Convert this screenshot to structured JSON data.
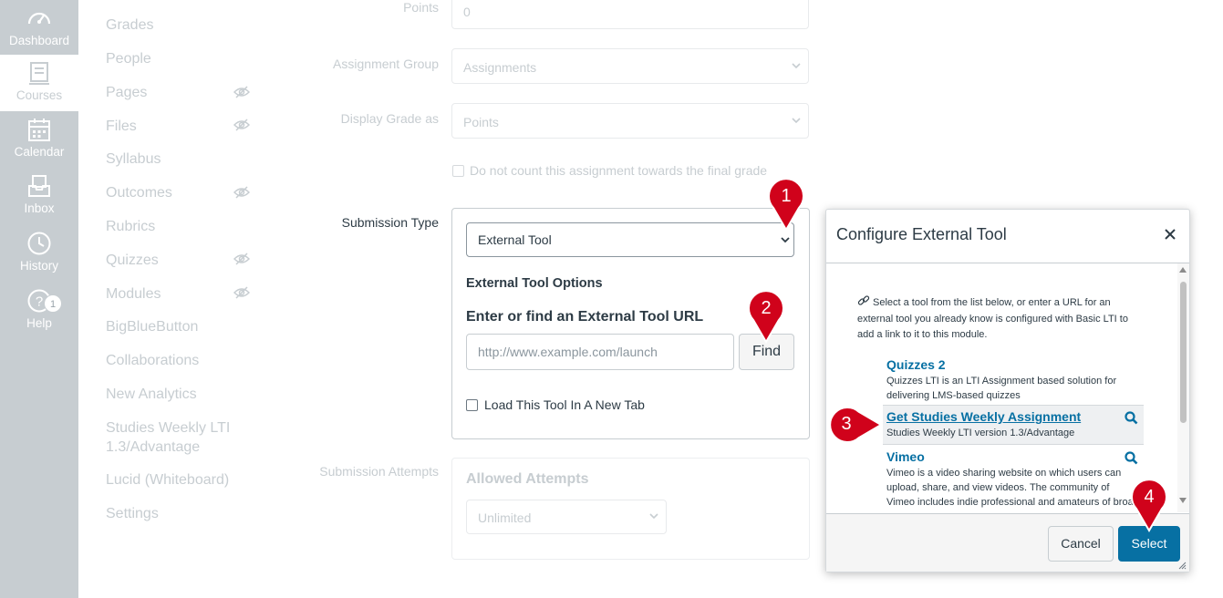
{
  "global_nav": {
    "dashboard": "Dashboard",
    "courses": "Courses",
    "calendar": "Calendar",
    "inbox": "Inbox",
    "history": "History",
    "help": "Help",
    "help_badge": "1"
  },
  "course_nav": [
    "Grades",
    "People",
    "Pages",
    "Files",
    "Syllabus",
    "Outcomes",
    "Rubrics",
    "Quizzes",
    "Modules",
    "BigBlueButton",
    "Collaborations",
    "New Analytics",
    "Studies Weekly LTI 1.3/Advantage",
    "Lucid (Whiteboard)",
    "Settings"
  ],
  "form": {
    "points_label": "Points",
    "points_value": "0",
    "group_label": "Assignment Group",
    "group_value": "Assignments",
    "display_label": "Display Grade as",
    "display_value": "Points",
    "no_count_label": "Do not count this assignment towards the final grade",
    "submission_label": "Submission Type",
    "submission_value": "External Tool",
    "ext_options_heading": "External Tool Options",
    "ext_url_heading": "Enter or find an External Tool URL",
    "url_placeholder": "http://www.example.com/launch",
    "find_label": "Find",
    "new_tab_label": "Load This Tool In A New Tab",
    "attempts_label": "Submission Attempts",
    "allowed_heading": "Allowed Attempts",
    "allowed_value": "Unlimited"
  },
  "modal": {
    "title": "Configure External Tool",
    "intro": "Select a tool from the list below, or enter a URL for an external tool you already know is configured with Basic LTI to add a link to it to this module.",
    "tools": [
      {
        "name": "Quizzes 2",
        "desc": "Quizzes LTI is an LTI Assignment based solution for delivering LMS-based quizzes"
      },
      {
        "name": "Get Studies Weekly Assignment",
        "desc": "Studies Weekly LTI version 1.3/Advantage"
      },
      {
        "name": "Vimeo",
        "desc": "Vimeo is a video sharing website on which users can upload, share, and view videos. The community of Vimeo includes indie professional and amateurs of broad"
      }
    ],
    "cancel_label": "Cancel",
    "select_label": "Select"
  },
  "callouts": [
    "1",
    "2",
    "3",
    "4"
  ],
  "colors": {
    "callout": "#d0021b",
    "primary": "#0770a3",
    "nav_bg": "#c7cdd1"
  }
}
